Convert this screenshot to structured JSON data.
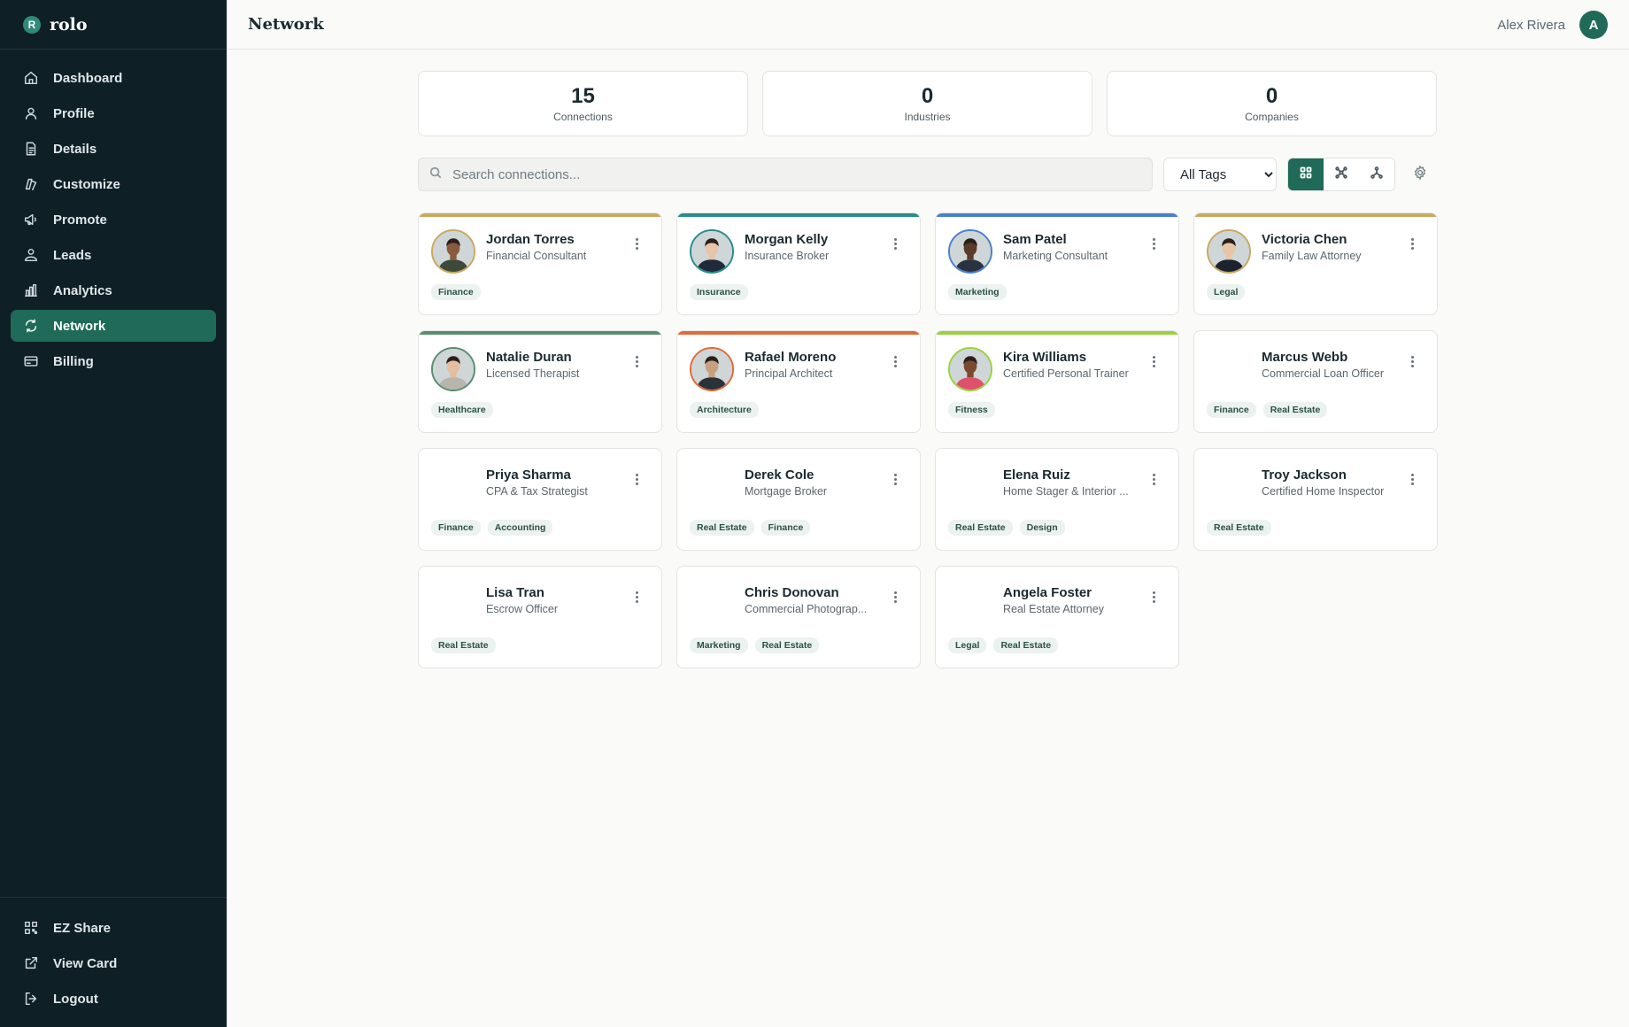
{
  "app": {
    "logo_letter": "R",
    "name": "rolo"
  },
  "sidebar": {
    "items": [
      {
        "label": "Dashboard",
        "icon": "home-icon"
      },
      {
        "label": "Profile",
        "icon": "user-icon"
      },
      {
        "label": "Details",
        "icon": "document-icon"
      },
      {
        "label": "Customize",
        "icon": "palette-icon"
      },
      {
        "label": "Promote",
        "icon": "megaphone-icon"
      },
      {
        "label": "Leads",
        "icon": "leads-icon"
      },
      {
        "label": "Analytics",
        "icon": "bar-chart-icon"
      },
      {
        "label": "Network",
        "icon": "network-icon",
        "active": true
      },
      {
        "label": "Billing",
        "icon": "credit-card-icon"
      }
    ],
    "bottom_items": [
      {
        "label": "EZ Share",
        "icon": "qr-icon"
      },
      {
        "label": "View Card",
        "icon": "external-link-icon"
      },
      {
        "label": "Logout",
        "icon": "logout-icon"
      }
    ]
  },
  "header": {
    "title": "Network",
    "user_name": "Alex Rivera",
    "avatar_letter": "A"
  },
  "stats": [
    {
      "value": "15",
      "label": "Connections"
    },
    {
      "value": "0",
      "label": "Industries"
    },
    {
      "value": "0",
      "label": "Companies"
    }
  ],
  "search": {
    "placeholder": "Search connections...",
    "value": ""
  },
  "tag_filter": {
    "selected": "All Tags"
  },
  "view_modes": [
    "grid-view-icon",
    "cluster-view-icon",
    "tree-view-icon"
  ],
  "active_view": "grid-view-icon",
  "colors": {
    "sidebar_bg": "#0f1f26",
    "accent": "#1f6a58",
    "tag_bg": "#ecf2ef"
  },
  "connections": [
    {
      "name": "Jordan Torres",
      "title": "Financial Consultant",
      "tags": [
        "Finance"
      ],
      "accent": "#c9a860",
      "photo": true,
      "skin": "#8a5a3c",
      "shirt": "#3d4a3a"
    },
    {
      "name": "Morgan Kelly",
      "title": "Insurance Broker",
      "tags": [
        "Insurance"
      ],
      "accent": "#2a8c8c",
      "photo": true,
      "skin": "#e8c4a8",
      "shirt": "#1f2a3a"
    },
    {
      "name": "Sam Patel",
      "title": "Marketing Consultant",
      "tags": [
        "Marketing"
      ],
      "accent": "#4a7fd0",
      "photo": true,
      "skin": "#5a3a28",
      "shirt": "#2a3140"
    },
    {
      "name": "Victoria Chen",
      "title": "Family Law Attorney",
      "tags": [
        "Legal"
      ],
      "accent": "#c9a860",
      "photo": true,
      "skin": "#e6c6a6",
      "shirt": "#1c2230"
    },
    {
      "name": "Natalie Duran",
      "title": "Licensed Therapist",
      "tags": [
        "Healthcare"
      ],
      "accent": "#5a8c70",
      "photo": true,
      "skin": "#e3bfa0",
      "shirt": "#b8b4ae"
    },
    {
      "name": "Rafael Moreno",
      "title": "Principal Architect",
      "tags": [
        "Architecture"
      ],
      "accent": "#e06a3a",
      "photo": true,
      "skin": "#c8a080",
      "shirt": "#2c3138"
    },
    {
      "name": "Kira Williams",
      "title": "Certified Personal Trainer",
      "tags": [
        "Fitness"
      ],
      "accent": "#9ad23c",
      "photo": true,
      "skin": "#7a4a30",
      "shirt": "#e0506a"
    },
    {
      "name": "Marcus Webb",
      "title": "Commercial Loan Officer",
      "tags": [
        "Finance",
        "Real Estate"
      ],
      "accent": "",
      "photo": false
    },
    {
      "name": "Priya Sharma",
      "title": "CPA & Tax Strategist",
      "tags": [
        "Finance",
        "Accounting"
      ],
      "accent": "",
      "photo": false
    },
    {
      "name": "Derek Cole",
      "title": "Mortgage Broker",
      "tags": [
        "Real Estate",
        "Finance"
      ],
      "accent": "",
      "photo": false
    },
    {
      "name": "Elena Ruiz",
      "title": "Home Stager & Interior ...",
      "tags": [
        "Real Estate",
        "Design"
      ],
      "accent": "",
      "photo": false
    },
    {
      "name": "Troy Jackson",
      "title": "Certified Home Inspector",
      "tags": [
        "Real Estate"
      ],
      "accent": "",
      "photo": false
    },
    {
      "name": "Lisa Tran",
      "title": "Escrow Officer",
      "tags": [
        "Real Estate"
      ],
      "accent": "",
      "photo": false
    },
    {
      "name": "Chris Donovan",
      "title": "Commercial Photograp...",
      "tags": [
        "Marketing",
        "Real Estate"
      ],
      "accent": "",
      "photo": false
    },
    {
      "name": "Angela Foster",
      "title": "Real Estate Attorney",
      "tags": [
        "Legal",
        "Real Estate"
      ],
      "accent": "",
      "photo": false
    }
  ]
}
